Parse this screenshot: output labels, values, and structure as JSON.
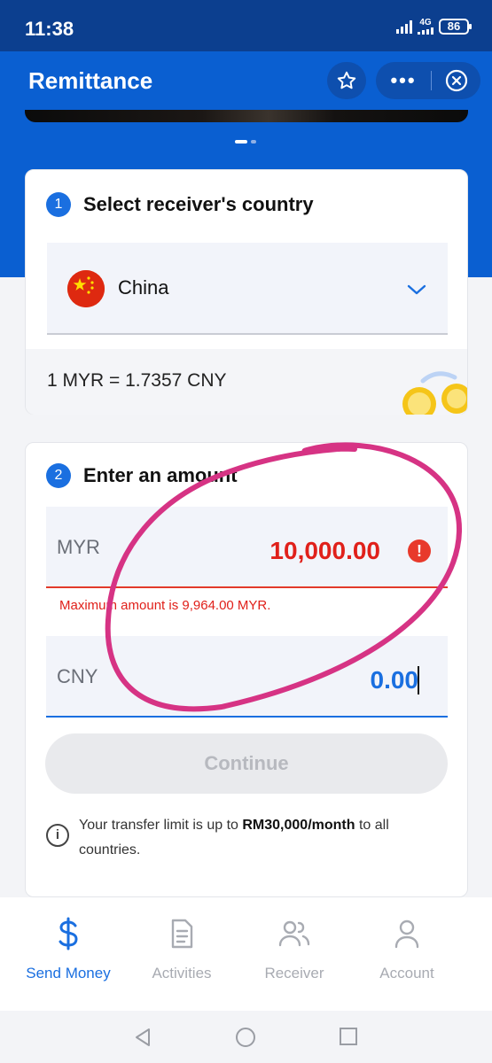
{
  "status_bar": {
    "time": "11:38",
    "network": "4G",
    "battery": "86"
  },
  "header": {
    "title": "Remittance",
    "more_label": "•••"
  },
  "step1": {
    "number": "1",
    "title": "Select receiver's country",
    "country": "China",
    "rate": "1 MYR = 1.7357 CNY"
  },
  "step2": {
    "number": "2",
    "title": "Enter an amount",
    "source_currency": "MYR",
    "source_amount": "10,000.00",
    "error_message": "Maximum amount is 9,964.00 MYR.",
    "target_currency": "CNY",
    "target_amount": "0.00",
    "continue_label": "Continue",
    "limit_prefix": "Your transfer limit is up to ",
    "limit_value": "RM30,000/month",
    "limit_suffix": " to all countries."
  },
  "bottom_nav": [
    {
      "label": "Send Money",
      "icon": "dollar-icon",
      "active": true
    },
    {
      "label": "Activities",
      "icon": "document-icon",
      "active": false
    },
    {
      "label": "Receiver",
      "icon": "people-icon",
      "active": false
    },
    {
      "label": "Account",
      "icon": "person-icon",
      "active": false
    }
  ],
  "colors": {
    "brand_blue": "#0a5fd1",
    "error_red": "#e0201a",
    "annotation_pink": "#d63384"
  }
}
